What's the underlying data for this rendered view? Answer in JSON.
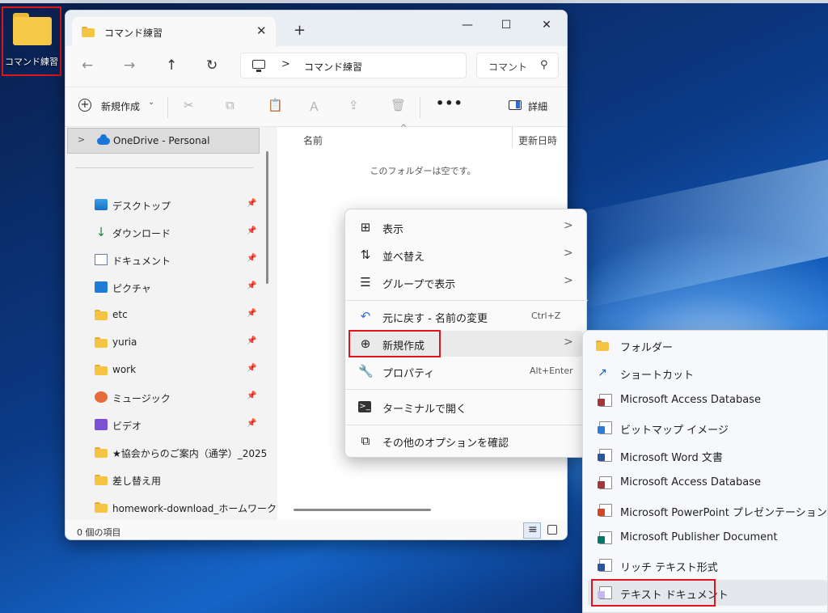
{
  "desktop": {
    "icon_label": "コマンド練習"
  },
  "window": {
    "tab_title": "コマンド練習",
    "tab_close": "✕",
    "new_tab": "+",
    "minimize": "—",
    "maximize": "☐",
    "close": "✕"
  },
  "nav": {
    "back": "←",
    "forward": "→",
    "up": "↑",
    "refresh": "↻",
    "address_sep": ">",
    "address_path": "コマンド練習",
    "search_placeholder": "コマント"
  },
  "toolbar": {
    "new_label": "新規作成",
    "more": "•••",
    "details_label": "詳細",
    "icons": {
      "cut": "✂",
      "copy": "⧉",
      "paste": "📋",
      "rename": "Ａ",
      "share": "⇪",
      "delete": "🗑"
    }
  },
  "navpane": {
    "onedrive": "OneDrive - Personal",
    "items": [
      {
        "label": "デスクトップ",
        "icon": "desktop-icon",
        "pinned": true
      },
      {
        "label": "ダウンロード",
        "icon": "download-icon",
        "pinned": true
      },
      {
        "label": "ドキュメント",
        "icon": "document-icon",
        "pinned": true
      },
      {
        "label": "ピクチャ",
        "icon": "pictures-icon",
        "pinned": true
      },
      {
        "label": "etc",
        "icon": "folder-icon",
        "pinned": true
      },
      {
        "label": "yuria",
        "icon": "folder-icon",
        "pinned": true
      },
      {
        "label": "work",
        "icon": "folder-icon",
        "pinned": true
      },
      {
        "label": "ミュージック",
        "icon": "music-icon",
        "pinned": true
      },
      {
        "label": "ビデオ",
        "icon": "video-icon",
        "pinned": true
      },
      {
        "label": "★協会からのご案内（通学）_2025",
        "icon": "folder-icon",
        "pinned": false
      },
      {
        "label": "差し替え用",
        "icon": "folder-icon",
        "pinned": false
      },
      {
        "label": "homework-download_ホームワーク",
        "icon": "folder-icon",
        "pinned": false
      }
    ]
  },
  "content": {
    "col_name": "名前",
    "col_date": "更新日時",
    "empty_message": "このフォルダーは空です。"
  },
  "status": {
    "item_count": "0 個の項目"
  },
  "context_menu": {
    "items": [
      {
        "label": "表示",
        "icon": "view-icon",
        "submenu": true
      },
      {
        "label": "並べ替え",
        "icon": "sort-icon",
        "submenu": true
      },
      {
        "label": "グループで表示",
        "icon": "group-icon",
        "submenu": true
      },
      {
        "label": "元に戻す - 名前の変更",
        "icon": "undo-icon",
        "shortcut": "Ctrl+Z"
      },
      {
        "label": "新規作成",
        "icon": "new-icon",
        "submenu": true
      },
      {
        "label": "プロパティ",
        "icon": "properties-icon",
        "shortcut": "Alt+Enter"
      },
      {
        "label": "ターミナルで開く",
        "icon": "terminal-icon"
      },
      {
        "label": "その他のオプションを確認",
        "icon": "more-options-icon"
      }
    ]
  },
  "submenu": {
    "items": [
      {
        "label": "フォルダー",
        "icon": "folder-icon"
      },
      {
        "label": "ショートカット",
        "icon": "shortcut-icon"
      },
      {
        "label": "Microsoft Access Database",
        "icon": "access-icon",
        "color": "#a4373a"
      },
      {
        "label": "ビットマップ イメージ",
        "icon": "bitmap-icon",
        "color": "#2b7cd3"
      },
      {
        "label": "Microsoft Word 文書",
        "icon": "word-icon",
        "color": "#2b579a"
      },
      {
        "label": "Microsoft Access Database",
        "icon": "access-icon",
        "color": "#a4373a"
      },
      {
        "label": "Microsoft PowerPoint プレゼンテーション",
        "icon": "powerpoint-icon",
        "color": "#d24726"
      },
      {
        "label": "Microsoft Publisher Document",
        "icon": "publisher-icon",
        "color": "#077568"
      },
      {
        "label": "リッチ テキスト形式",
        "icon": "rtf-icon",
        "color": "#2b579a"
      },
      {
        "label": "テキスト ドキュメント",
        "icon": "text-document-icon",
        "color": "#c7b7f0"
      }
    ]
  },
  "colors": {
    "accent": "#0067c0",
    "highlight_box": "#e0151b",
    "folder": "#f6c443"
  }
}
